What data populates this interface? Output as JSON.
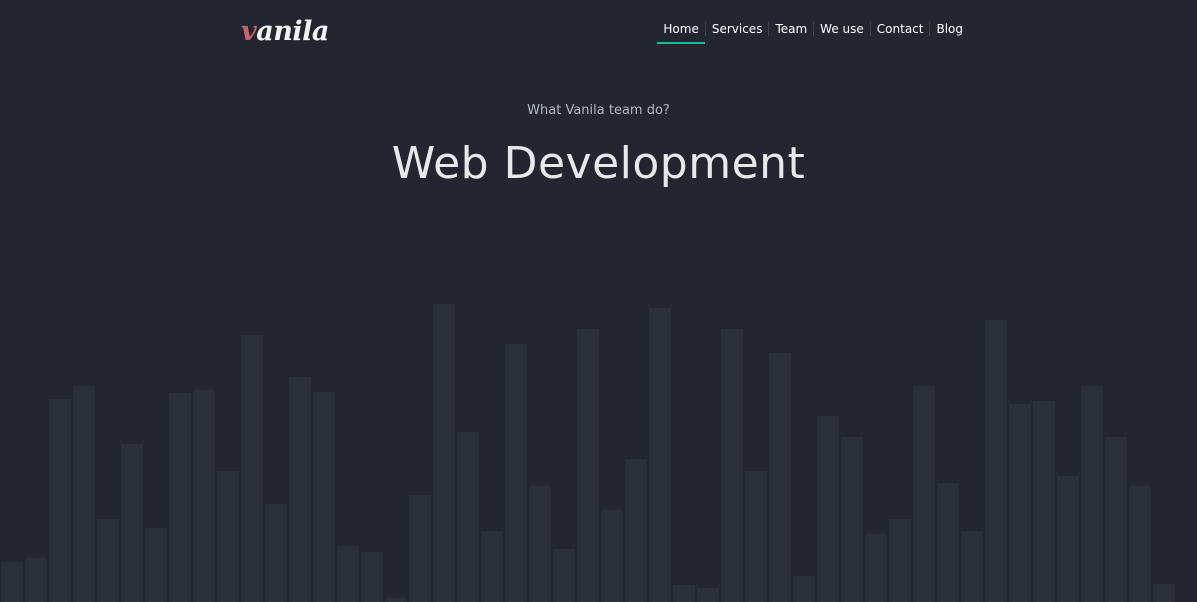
{
  "logo": {
    "accent_letter": "v",
    "rest": "anila",
    "accent_color": "#c9616a"
  },
  "nav": {
    "items": [
      "Home",
      "Services",
      "Team",
      "We use",
      "Contact",
      "Blog"
    ],
    "active": "Home",
    "active_color": "#1fb5a0"
  },
  "hero": {
    "subtitle": "What Vanila team do?",
    "title": "Web Development"
  },
  "background_bars": {
    "color": "#2b2f38",
    "heights": [
      40,
      44,
      203,
      216,
      83,
      158,
      74,
      209,
      212,
      131,
      267,
      98,
      225,
      210,
      56,
      50,
      4,
      107,
      298,
      170,
      71,
      258,
      116,
      53,
      273,
      92,
      143,
      294,
      17,
      14,
      273,
      131,
      249,
      26,
      186,
      165,
      68,
      83,
      216,
      119,
      71,
      282,
      198,
      201,
      126,
      216,
      165,
      116,
      18
    ]
  }
}
